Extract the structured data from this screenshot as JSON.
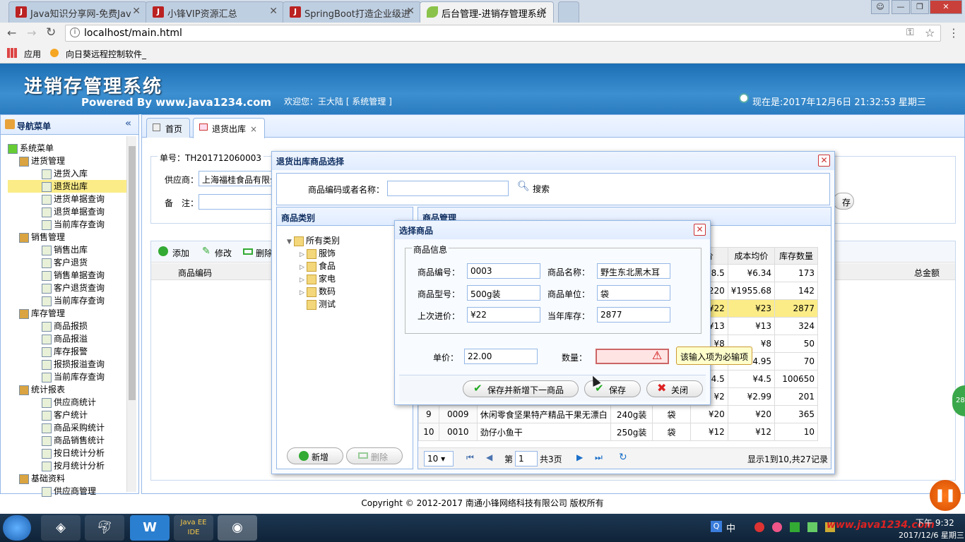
{
  "browser": {
    "tabs": [
      {
        "title": "Java知识分享网-免费Jav",
        "icon": "J"
      },
      {
        "title": "小锋VIP资源汇总",
        "icon": "J"
      },
      {
        "title": "SpringBoot打造企业级进",
        "icon": "J"
      },
      {
        "title": "后台管理-进销存管理系统",
        "icon": "leaf"
      }
    ],
    "url": "localhost/main.html",
    "bookmarks": [
      "应用",
      "向日葵远程控制软件_"
    ]
  },
  "app": {
    "title": "进销存管理系统",
    "subtitle": "Powered By www.java1234.com",
    "welcome": "欢迎您：王大陆 [ 系统管理 ]",
    "datetime": "现在是:2017年12月6日 21:32:53 星期三",
    "footer": "Copyright © 2012-2017 南通小锋网络科技有限公司 版权所有"
  },
  "nav": {
    "title": "导航菜单",
    "items": [
      {
        "label": "系统菜单",
        "level": 0
      },
      {
        "label": "进货管理",
        "level": 1
      },
      {
        "label": "进货入库",
        "level": 2
      },
      {
        "label": "退货出库",
        "level": 2,
        "selected": true
      },
      {
        "label": "进货单据查询",
        "level": 2
      },
      {
        "label": "退货单据查询",
        "level": 2
      },
      {
        "label": "当前库存查询",
        "level": 2
      },
      {
        "label": "销售管理",
        "level": 1
      },
      {
        "label": "销售出库",
        "level": 2
      },
      {
        "label": "客户退货",
        "level": 2
      },
      {
        "label": "销售单据查询",
        "level": 2
      },
      {
        "label": "客户退货查询",
        "level": 2
      },
      {
        "label": "当前库存查询",
        "level": 2
      },
      {
        "label": "库存管理",
        "level": 1
      },
      {
        "label": "商品报损",
        "level": 2
      },
      {
        "label": "商品报溢",
        "level": 2
      },
      {
        "label": "库存报警",
        "level": 2
      },
      {
        "label": "报损报溢查询",
        "level": 2
      },
      {
        "label": "当前库存查询",
        "level": 2
      },
      {
        "label": "统计报表",
        "level": 1
      },
      {
        "label": "供应商统计",
        "level": 2
      },
      {
        "label": "客户统计",
        "level": 2
      },
      {
        "label": "商品采购统计",
        "level": 2
      },
      {
        "label": "商品销售统计",
        "level": 2
      },
      {
        "label": "按日统计分析",
        "level": 2
      },
      {
        "label": "按月统计分析",
        "level": 2
      },
      {
        "label": "基础资料",
        "level": 1
      },
      {
        "label": "供应商管理",
        "level": 2
      }
    ]
  },
  "tabs": [
    {
      "label": "首页"
    },
    {
      "label": "退货出库"
    }
  ],
  "form": {
    "order_no": "单号：TH201712060003",
    "supplier_label": "供应商：",
    "supplier_value": "上海福桂食品有限公司",
    "remark_label": "备　注：",
    "save_tail": "存"
  },
  "toolbar": {
    "add": "添加",
    "edit": "修改",
    "delete": "删除"
  },
  "main_grid": {
    "col_code": "商品编码",
    "col_total": "总金额"
  },
  "select_dialog": {
    "title": "退货出库商品选择",
    "search_label": "商品编码或者名称：",
    "search_button": "搜索",
    "category_title": "商品类别",
    "categories": [
      {
        "label": "所有类别",
        "level": 0
      },
      {
        "label": "服饰",
        "level": 1
      },
      {
        "label": "食品",
        "level": 1
      },
      {
        "label": "家电",
        "level": 1
      },
      {
        "label": "数码",
        "level": 1
      },
      {
        "label": "测试",
        "level": 1
      }
    ],
    "add_button": "新增",
    "delete_button": "删除",
    "goods_title": "商品管理",
    "headers": {
      "price_tail": "价",
      "cost": "成本均价",
      "stock": "库存数量"
    },
    "rows": [
      {
        "price": "8.5",
        "cost": "¥6.34",
        "stock": "173"
      },
      {
        "price": "220",
        "cost": "¥1955.68",
        "stock": "142"
      },
      {
        "price": "¥22",
        "cost": "¥23",
        "stock": "2877",
        "highlight": true
      },
      {
        "price": "¥13",
        "cost": "¥13",
        "stock": "324"
      },
      {
        "price": "¥8",
        "cost": "¥8",
        "stock": "50"
      },
      {
        "price": "4.95",
        "cost": "4.95",
        "stock": "70"
      },
      {
        "price": "4.5",
        "cost": "¥4.5",
        "stock": "100650"
      },
      {
        "price": "¥2",
        "cost": "¥2.99",
        "stock": "201"
      },
      {
        "num": "9",
        "code": "0009",
        "name": "休闲零食坚果特产精品干果无漂白",
        "model": "240g装",
        "unit": "袋",
        "price": "¥20",
        "cost": "¥20",
        "stock": "365"
      },
      {
        "num": "10",
        "code": "0010",
        "name": "劲仔小鱼干",
        "model": "250g装",
        "unit": "袋",
        "price": "¥12",
        "cost": "¥12",
        "stock": "10"
      }
    ],
    "pager": {
      "page_size": "10",
      "page_prefix": "第",
      "page": "1",
      "page_total": "共3页",
      "summary": "显示1到10,共27记录"
    }
  },
  "choose_dialog": {
    "title": "选择商品",
    "legend": "商品信息",
    "code_label": "商品编号：",
    "code": "0003",
    "name_label": "商品名称：",
    "name": "野生东北黑木耳",
    "model_label": "商品型号：",
    "model": "500g装",
    "unit_label": "商品单位：",
    "unit": "袋",
    "last_price_label": "上次进价：",
    "last_price": "¥22",
    "stock_label": "当年库存：",
    "stock": "2877",
    "price_label": "单价：",
    "price": "22.00",
    "qty_label": "数量：",
    "qty": "",
    "tooltip": "该输入项为必输项",
    "btn_save_next": "保存并新增下一商品",
    "btn_save": "保存",
    "btn_close": "关闭"
  },
  "taskbar": {
    "ime": "中",
    "time": "下午 9:32",
    "date": "2017/12/6 星期三",
    "watermark": "www.java1234.com",
    "badge": "28"
  },
  "colors": {
    "header": "#2a7cc0",
    "panel_border": "#95b8e7",
    "highlight_row": "#fbec88",
    "error": "#ffe4e4"
  }
}
